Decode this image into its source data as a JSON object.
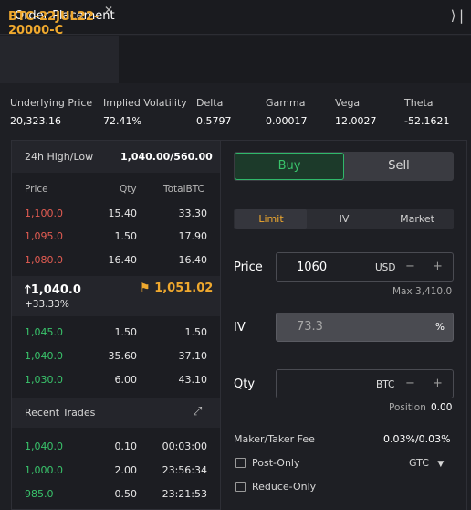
{
  "panel": {
    "title": "Order Placement",
    "collapse_glyph": "⟩|"
  },
  "tab": {
    "label": "BTC-22JUL22-20000-C",
    "close_glyph": "✕"
  },
  "greeks": [
    {
      "label": "Underlying Price",
      "value": "20,323.16"
    },
    {
      "label": "Implied Volatility",
      "value": "72.41%"
    },
    {
      "label": "Delta",
      "value": "0.5797"
    },
    {
      "label": "Gamma",
      "value": "0.00017"
    },
    {
      "label": "Vega",
      "value": "12.0027"
    },
    {
      "label": "Theta",
      "value": "-52.1621"
    }
  ],
  "orderbook": {
    "high_low_label": "24h High/Low",
    "high_low_value": "1,040.00/560.00",
    "columns": [
      "Price",
      "Qty",
      "TotalBTC"
    ],
    "asks": [
      {
        "price": "1,100.0",
        "qty": "15.40",
        "total": "33.30"
      },
      {
        "price": "1,095.0",
        "qty": "1.50",
        "total": "17.90"
      },
      {
        "price": "1,080.0",
        "qty": "16.40",
        "total": "16.40"
      }
    ],
    "last_price": "1,040.0",
    "last_arrow": "🡑",
    "change": "+33.33%",
    "mark_price": "1,051.02",
    "mark_glyph": "⚑",
    "bids": [
      {
        "price": "1,045.0",
        "qty": "1.50",
        "total": "1.50"
      },
      {
        "price": "1,040.0",
        "qty": "35.60",
        "total": "37.10"
      },
      {
        "price": "1,030.0",
        "qty": "6.00",
        "total": "43.10"
      }
    ]
  },
  "recent_trades": {
    "title": "Recent Trades",
    "expand_glyph": "⤢",
    "rows": [
      {
        "price": "1,040.0",
        "qty": "0.10",
        "time": "00:03:00",
        "side": "buy"
      },
      {
        "price": "1,000.0",
        "qty": "2.00",
        "time": "23:56:34",
        "side": "buy"
      },
      {
        "price": "985.0",
        "qty": "0.50",
        "time": "23:21:53",
        "side": "buy"
      }
    ]
  },
  "form": {
    "buy_label": "Buy",
    "sell_label": "Sell",
    "order_types": [
      "Limit",
      "IV",
      "Market"
    ],
    "active_order_type": "Limit",
    "price_label": "Price",
    "price_value": "1060",
    "price_unit": "USD",
    "max_hint": "Max 3,410.0",
    "iv_label": "IV",
    "iv_value": "73.3",
    "iv_unit": "%",
    "qty_label": "Qty",
    "qty_unit": "BTC",
    "position_label": "Position",
    "position_value": "0.00",
    "fee_label": "Maker/Taker Fee",
    "fee_value": "0.03%/0.03%",
    "post_only_label": "Post-Only",
    "tif_value": "GTC",
    "reduce_only_label": "Reduce-Only",
    "minus_glyph": "−",
    "plus_glyph": "+",
    "dropdown_glyph": "▼"
  },
  "colors": {
    "accent": "#f0a92e",
    "buy": "#39c36b",
    "sell": "#e25c52",
    "background": "#1e1f24"
  }
}
